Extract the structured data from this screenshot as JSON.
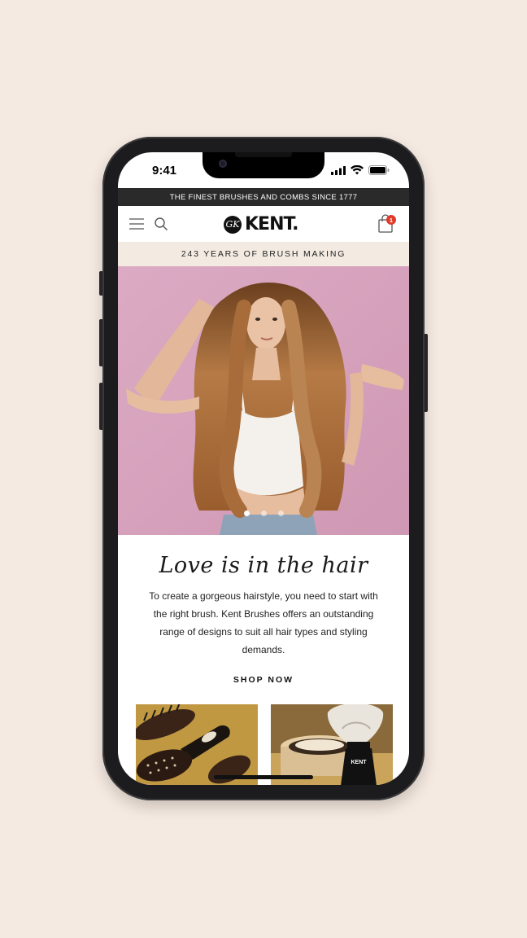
{
  "status_bar": {
    "time": "9:41"
  },
  "announcement": {
    "text": "THE FINEST BRUSHES AND COMBS SINCE 1777"
  },
  "header": {
    "logo_text": "KENT.",
    "bag_count": "1"
  },
  "promo": {
    "text": "243 YEARS OF BRUSH MAKING"
  },
  "hero": {
    "slide_count": 3,
    "active_slide": 1
  },
  "intro": {
    "title": "Love is in the hair",
    "body": "To create a gorgeous hairstyle, you need to start with the right brush. Kent Brushes offers an outstanding range of designs to suit all hair types and styling demands.",
    "cta": "SHOP NOW"
  },
  "colors": {
    "background": "#f5eae1",
    "announcement_bar": "#2a2a2a",
    "promo_bar": "#f3ebe2",
    "badge": "#e03a2b",
    "hero_wall": "#d8a5be"
  },
  "icons": [
    "menu-icon",
    "search-icon",
    "shopping-bag-icon",
    "signal-icon",
    "wifi-icon",
    "battery-icon"
  ]
}
